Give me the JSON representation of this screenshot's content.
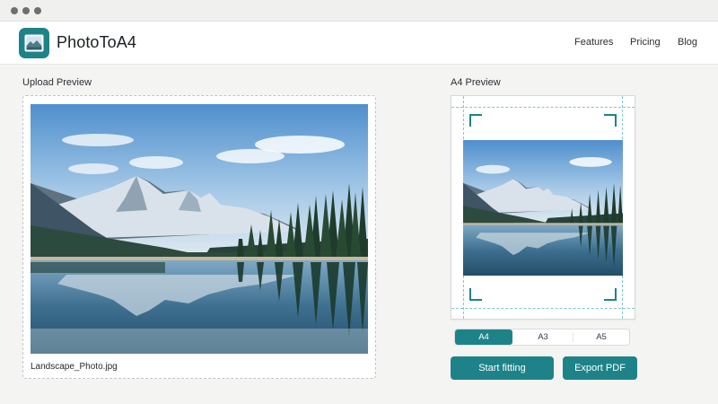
{
  "window": {
    "controls": [
      "window-dot",
      "window-dot",
      "window-dot"
    ]
  },
  "header": {
    "brand": "PhotoToA4",
    "logo_icon": "photo-icon",
    "nav": [
      "Features",
      "Pricing",
      "Blog"
    ]
  },
  "upload": {
    "label": "Upload Preview",
    "filename": "Landscape_Photo.jpg"
  },
  "preview": {
    "label": "A4 Preview",
    "sizes": [
      "A4",
      "A3",
      "A5"
    ],
    "selected_size": "A4"
  },
  "actions": {
    "start_label": "Start fitting",
    "export_label": "Export PDF"
  },
  "colors": {
    "accent": "#1d8389",
    "background": "#f4f4f3",
    "guide": "#7ec9cc"
  }
}
